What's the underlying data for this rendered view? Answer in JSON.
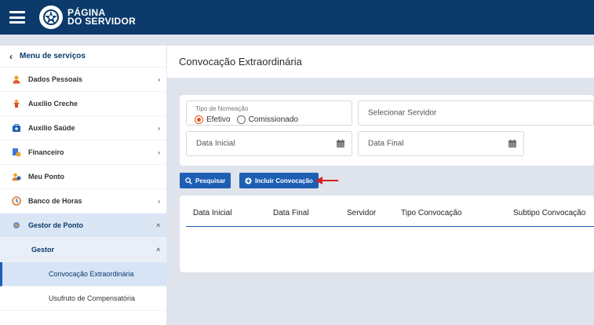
{
  "header": {
    "logo_line1": "PÁGINA",
    "logo_line2": "DO SERVIDOR"
  },
  "sidebar": {
    "header_label": "Menu de serviços",
    "items": [
      {
        "label": "Dados Pessoais",
        "icon": "person-icon",
        "chevron": "›"
      },
      {
        "label": "Auxílio Creche",
        "icon": "child-icon",
        "chevron": ""
      },
      {
        "label": "Auxílio Saúde",
        "icon": "medical-kit-icon",
        "chevron": "›"
      },
      {
        "label": "Financeiro",
        "icon": "finance-icon",
        "chevron": "›"
      },
      {
        "label": "Meu Ponto",
        "icon": "user-clock-icon",
        "chevron": ""
      },
      {
        "label": "Banco de Horas",
        "icon": "clock-icon",
        "chevron": "›"
      },
      {
        "label": "Gestor de Ponto",
        "icon": "gear-icon",
        "chevron": "˄"
      }
    ],
    "sub_item": {
      "label": "Gestor",
      "chevron": "˄"
    },
    "leaf_items": [
      {
        "label": "Convocação Extraordinária"
      },
      {
        "label": "Usufruto de Compensatória"
      }
    ]
  },
  "page": {
    "title": "Convocação Extraordinária"
  },
  "form": {
    "tipo_label": "Tipo de Nomeação",
    "options": [
      "Efetivo",
      "Comissionado"
    ],
    "selected_option": "Efetivo",
    "servidor_placeholder": "Selecionar Servidor",
    "data_inicial_placeholder": "Data Inicial",
    "data_final_placeholder": "Data Final"
  },
  "actions": {
    "search_label": "Pesquisar",
    "include_label": "Incluir Convocação"
  },
  "table": {
    "columns": [
      "Data Inicial",
      "Data Final",
      "Servidor",
      "Tipo Convocação",
      "Subtipo Convocação"
    ]
  },
  "colors": {
    "topbar": "#0b3a6b",
    "primary": "#1e5fb4",
    "radio_selected": "#e8521f",
    "annotation_arrow": "#d62020"
  }
}
